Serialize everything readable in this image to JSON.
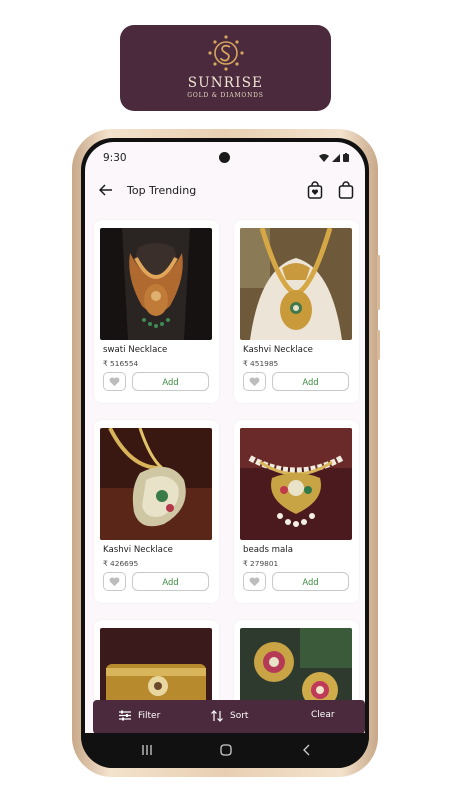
{
  "brand": {
    "name": "SUNRISE",
    "tagline": "GOLD & DIAMONDS"
  },
  "status_bar": {
    "time": "9:30"
  },
  "header": {
    "title": "Top Trending"
  },
  "products": [
    {
      "name": "swati Necklace",
      "price": "₹ 516554",
      "add_label": "Add"
    },
    {
      "name": "Kashvi Necklace",
      "price": "₹ 451985",
      "add_label": "Add"
    },
    {
      "name": "Kashvi Necklace",
      "price": "₹ 426695",
      "add_label": "Add"
    },
    {
      "name": "beads mala",
      "price": "₹ 279801",
      "add_label": "Add"
    }
  ],
  "bottom_bar": {
    "filter_label": "Filter",
    "sort_label": "Sort",
    "clear_label": "Clear"
  },
  "colors": {
    "brand_plum": "#4a2a3c",
    "add_green": "#3a8a3c",
    "background": "#fbf7fb"
  }
}
